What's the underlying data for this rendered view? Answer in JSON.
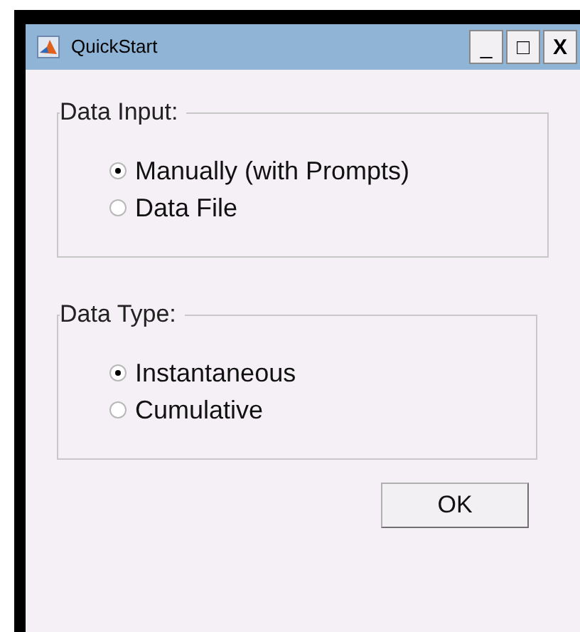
{
  "window": {
    "title": "QuickStart",
    "controls": [
      "_",
      "□",
      "X"
    ]
  },
  "groups": [
    {
      "title": "Data Input:",
      "options": [
        {
          "label": "Manually (with Prompts)",
          "selected": true
        },
        {
          "label": "Data File",
          "selected": false
        }
      ]
    },
    {
      "title": "Data Type:",
      "options": [
        {
          "label": "Instantaneous",
          "selected": true
        },
        {
          "label": "Cumulative",
          "selected": false
        }
      ]
    }
  ],
  "buttons": [
    "OK"
  ]
}
